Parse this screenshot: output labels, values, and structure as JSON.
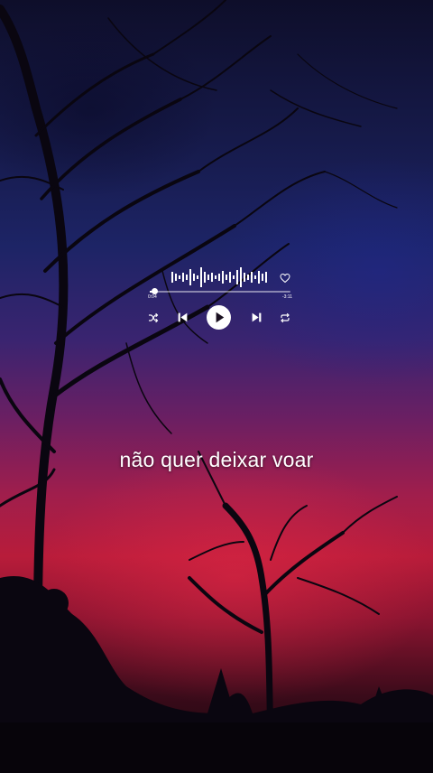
{
  "player": {
    "time_elapsed": "0:04",
    "time_remaining": "-3:11",
    "progress_fraction": 0.03,
    "liked": false,
    "icons": {
      "like": "heart-outline-icon",
      "shuffle": "shuffle-icon",
      "previous": "skip-previous-icon",
      "play": "play-icon",
      "next": "skip-next-icon",
      "repeat": "repeat-icon"
    }
  },
  "lyric": {
    "line": "não quer deixar voar"
  },
  "colors": {
    "sky_top": "#161a4a",
    "sky_mid": "#6a1f63",
    "sky_low": "#b81c3a",
    "ground": "#120408",
    "foreground": "#ffffff"
  }
}
